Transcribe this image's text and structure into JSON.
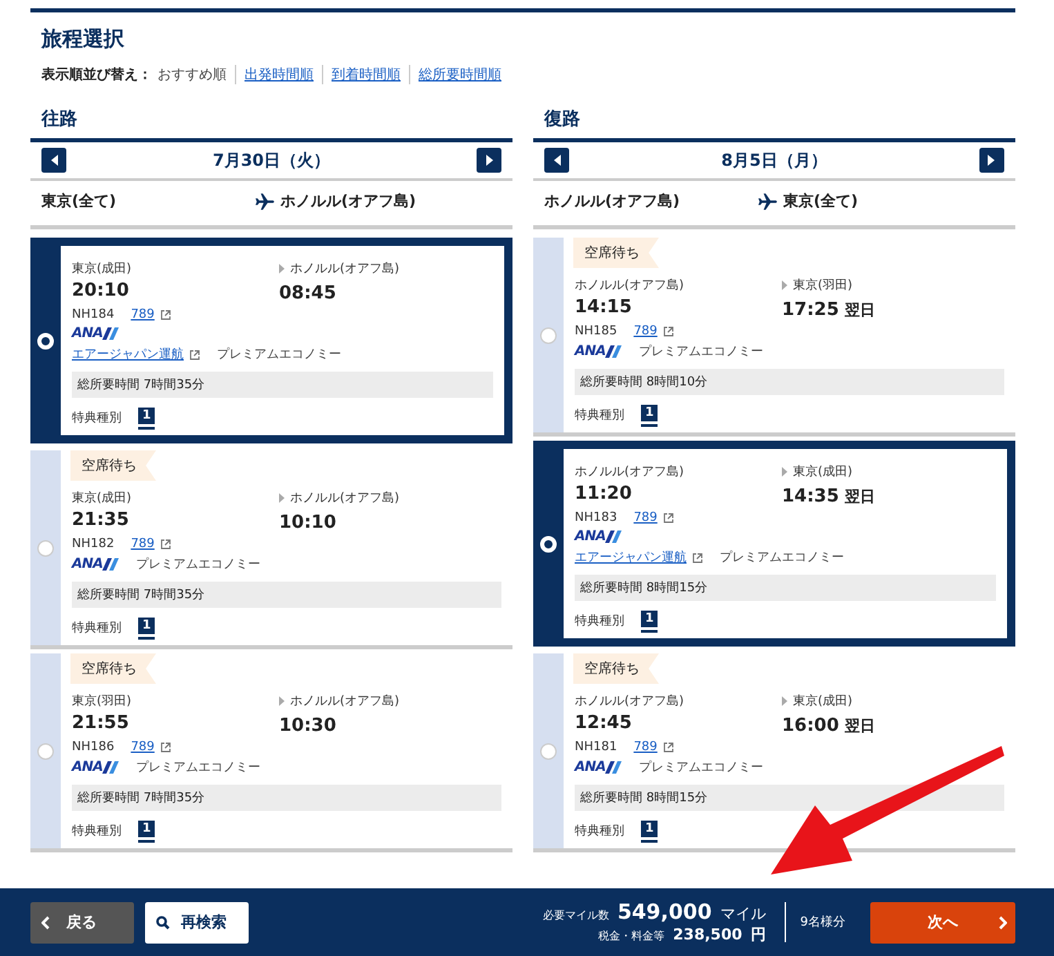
{
  "title": "旅程選択",
  "sort": {
    "label": "表示順並び替え：",
    "options": [
      {
        "label": "おすすめ順",
        "selected": true
      },
      {
        "label": "出発時間順",
        "selected": false
      },
      {
        "label": "到着時間順",
        "selected": false
      },
      {
        "label": "総所要時間順",
        "selected": false
      }
    ]
  },
  "legs": [
    {
      "heading": "往路",
      "date": "7月30日（火）",
      "from": "東京(全て)",
      "to": "ホノルル(オアフ島)",
      "flights": [
        {
          "selected": true,
          "dep_city": "東京(成田)",
          "dep_time": "20:10",
          "arr_city": "ホノルル(オアフ島)",
          "arr_time": "08:45",
          "flight_no": "NH184",
          "aircraft": "789",
          "airline": "ANA",
          "operator": "エアージャパン運航",
          "cabin": "プレミアムエコノミー",
          "duration": "総所要時間 7時間35分",
          "award_label": "特典種別",
          "award_type": "1"
        },
        {
          "selected": false,
          "badge": "空席待ち",
          "dep_city": "東京(成田)",
          "dep_time": "21:35",
          "arr_city": "ホノルル(オアフ島)",
          "arr_time": "10:10",
          "flight_no": "NH182",
          "aircraft": "789",
          "airline": "ANA",
          "cabin": "プレミアムエコノミー",
          "duration": "総所要時間 7時間35分",
          "award_label": "特典種別",
          "award_type": "1"
        },
        {
          "selected": false,
          "badge": "空席待ち",
          "dep_city": "東京(羽田)",
          "dep_time": "21:55",
          "arr_city": "ホノルル(オアフ島)",
          "arr_time": "10:30",
          "flight_no": "NH186",
          "aircraft": "789",
          "airline": "ANA",
          "cabin": "プレミアムエコノミー",
          "duration": "総所要時間 7時間35分",
          "award_label": "特典種別",
          "award_type": "1"
        }
      ]
    },
    {
      "heading": "復路",
      "date": "8月5日（月）",
      "from": "ホノルル(オアフ島)",
      "to": "東京(全て)",
      "flights": [
        {
          "selected": false,
          "badge": "空席待ち",
          "dep_city": "ホノルル(オアフ島)",
          "dep_time": "14:15",
          "arr_city": "東京(羽田)",
          "arr_time": "17:25",
          "next_day": "翌日",
          "flight_no": "NH185",
          "aircraft": "789",
          "airline": "ANA",
          "cabin": "プレミアムエコノミー",
          "duration": "総所要時間 8時間10分",
          "award_label": "特典種別",
          "award_type": "1"
        },
        {
          "selected": true,
          "dep_city": "ホノルル(オアフ島)",
          "dep_time": "11:20",
          "arr_city": "東京(成田)",
          "arr_time": "14:35",
          "next_day": "翌日",
          "flight_no": "NH183",
          "aircraft": "789",
          "airline": "ANA",
          "operator": "エアージャパン運航",
          "cabin": "プレミアムエコノミー",
          "duration": "総所要時間 8時間15分",
          "award_label": "特典種別",
          "award_type": "1"
        },
        {
          "selected": false,
          "badge": "空席待ち",
          "dep_city": "ホノルル(オアフ島)",
          "dep_time": "12:45",
          "arr_city": "東京(成田)",
          "arr_time": "16:00",
          "next_day": "翌日",
          "flight_no": "NH181",
          "aircraft": "789",
          "airline": "ANA",
          "cabin": "プレミアムエコノミー",
          "duration": "総所要時間 8時間15分",
          "award_label": "特典種別",
          "award_type": "1"
        }
      ]
    }
  ],
  "footer": {
    "back": "戻る",
    "research": "再検索",
    "miles_label": "必要マイル数",
    "miles": "549,000",
    "miles_unit": "マイル",
    "tax_label": "税金・料金等",
    "tax": "238,500",
    "tax_unit": "円",
    "pax": "9名様分",
    "next": "次へ"
  }
}
